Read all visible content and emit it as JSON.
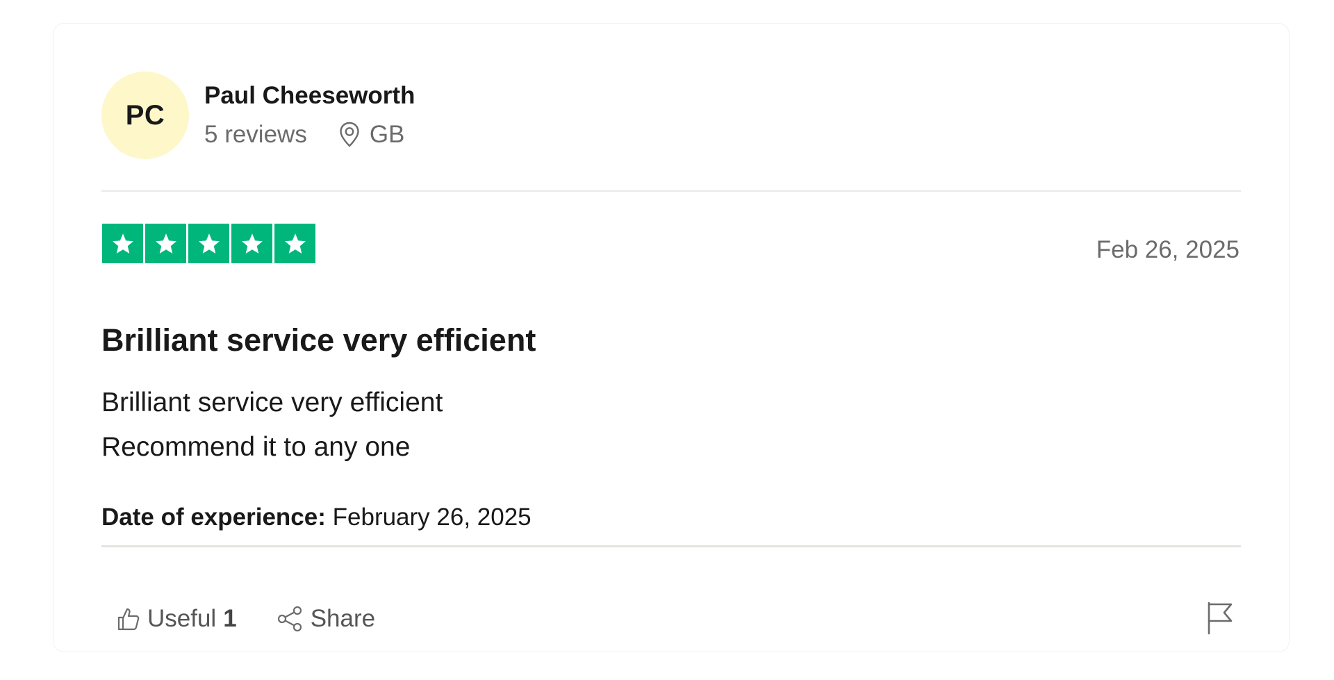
{
  "reviewer": {
    "initials": "PC",
    "name": "Paul Cheeseworth",
    "reviews_count": "5 reviews",
    "location": "GB",
    "location_icon": "location-pin-icon"
  },
  "review": {
    "rating": 5,
    "rating_max": 5,
    "date": "Feb 26, 2025",
    "title": "Brilliant service very efficient",
    "body_lines": [
      "Brilliant service very efficient",
      "Recommend it to any one"
    ],
    "experience_label": "Date of experience:",
    "experience_value": " February 26, 2025"
  },
  "actions": {
    "useful_label": "Useful",
    "useful_count": "1",
    "useful_icon": "thumbs-up-icon",
    "share_label": "Share",
    "share_icon": "share-icon",
    "flag_icon": "flag-icon"
  },
  "colors": {
    "star_green": "#00b67a",
    "avatar_bg": "#fdf7ca"
  }
}
